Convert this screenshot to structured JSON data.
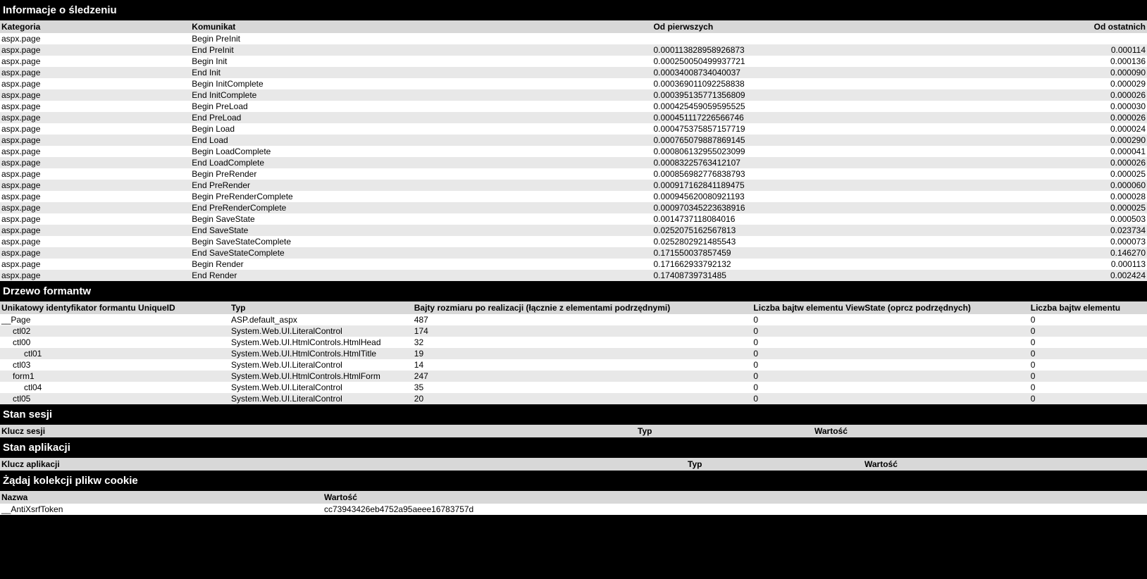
{
  "sections": {
    "trace_title": "Informacje o śledzeniu",
    "controltree_title": "Drzewo formantw",
    "session_title": "Stan sesji",
    "app_title": "Stan aplikacji",
    "cookies_title": "Żądaj kolekcji plikw cookie"
  },
  "trace": {
    "headers": {
      "category": "Kategoria",
      "message": "Komunikat",
      "from_first": "Od pierwszych",
      "from_last": "Od ostatnich"
    },
    "rows": [
      {
        "cat": "aspx.page",
        "msg": "Begin PreInit",
        "first": "",
        "last": ""
      },
      {
        "cat": "aspx.page",
        "msg": "End PreInit",
        "first": "0.000113828958926873",
        "last": "0.000114"
      },
      {
        "cat": "aspx.page",
        "msg": "Begin Init",
        "first": "0.000250050499937721",
        "last": "0.000136"
      },
      {
        "cat": "aspx.page",
        "msg": "End Init",
        "first": "0.00034008734040037",
        "last": "0.000090"
      },
      {
        "cat": "aspx.page",
        "msg": "Begin InitComplete",
        "first": "0.000369011092258838",
        "last": "0.000029"
      },
      {
        "cat": "aspx.page",
        "msg": "End InitComplete",
        "first": "0.000395135771356809",
        "last": "0.000026"
      },
      {
        "cat": "aspx.page",
        "msg": "Begin PreLoad",
        "first": "0.000425459059595525",
        "last": "0.000030"
      },
      {
        "cat": "aspx.page",
        "msg": "End PreLoad",
        "first": "0.000451117226566746",
        "last": "0.000026"
      },
      {
        "cat": "aspx.page",
        "msg": "Begin Load",
        "first": "0.000475375857157719",
        "last": "0.000024"
      },
      {
        "cat": "aspx.page",
        "msg": "End Load",
        "first": "0.000765079887869145",
        "last": "0.000290"
      },
      {
        "cat": "aspx.page",
        "msg": "Begin LoadComplete",
        "first": "0.000806132955023099",
        "last": "0.000041"
      },
      {
        "cat": "aspx.page",
        "msg": "End LoadComplete",
        "first": "0.00083225763412107",
        "last": "0.000026"
      },
      {
        "cat": "aspx.page",
        "msg": "Begin PreRender",
        "first": "0.000856982776838793",
        "last": "0.000025"
      },
      {
        "cat": "aspx.page",
        "msg": "End PreRender",
        "first": "0.000917162841189475",
        "last": "0.000060"
      },
      {
        "cat": "aspx.page",
        "msg": "Begin PreRenderComplete",
        "first": "0.000945620080921193",
        "last": "0.000028"
      },
      {
        "cat": "aspx.page",
        "msg": "End PreRenderComplete",
        "first": "0.000970345223638916",
        "last": "0.000025"
      },
      {
        "cat": "aspx.page",
        "msg": "Begin SaveState",
        "first": "0.0014737118084016",
        "last": "0.000503"
      },
      {
        "cat": "aspx.page",
        "msg": "End SaveState",
        "first": "0.0252075162567813",
        "last": "0.023734"
      },
      {
        "cat": "aspx.page",
        "msg": "Begin SaveStateComplete",
        "first": "0.0252802921485543",
        "last": "0.000073"
      },
      {
        "cat": "aspx.page",
        "msg": "End SaveStateComplete",
        "first": "0.171550037857459",
        "last": "0.146270"
      },
      {
        "cat": "aspx.page",
        "msg": "Begin Render",
        "first": "0.171662933792132",
        "last": "0.000113"
      },
      {
        "cat": "aspx.page",
        "msg": "End Render",
        "first": "0.17408739731485",
        "last": "0.002424"
      }
    ]
  },
  "controltree": {
    "headers": {
      "uid": "Unikatowy identyfikator formantu UniqueID",
      "type": "Typ",
      "render": "Bajty rozmiaru po realizacji (łącznie z elementami podrzędnymi)",
      "viewstate": "Liczba bajtw elementu ViewState (oprcz podrzędnych)",
      "controlstate": "Liczba bajtw elementu"
    },
    "rows": [
      {
        "indent": 0,
        "uid": "__Page",
        "type": "ASP.default_aspx",
        "render": "487",
        "vs": "0",
        "cs": "0"
      },
      {
        "indent": 1,
        "uid": "ctl02",
        "type": "System.Web.UI.LiteralControl",
        "render": "174",
        "vs": "0",
        "cs": "0"
      },
      {
        "indent": 1,
        "uid": "ctl00",
        "type": "System.Web.UI.HtmlControls.HtmlHead",
        "render": "32",
        "vs": "0",
        "cs": "0"
      },
      {
        "indent": 2,
        "uid": "ctl01",
        "type": "System.Web.UI.HtmlControls.HtmlTitle",
        "render": "19",
        "vs": "0",
        "cs": "0"
      },
      {
        "indent": 1,
        "uid": "ctl03",
        "type": "System.Web.UI.LiteralControl",
        "render": "14",
        "vs": "0",
        "cs": "0"
      },
      {
        "indent": 1,
        "uid": "form1",
        "type": "System.Web.UI.HtmlControls.HtmlForm",
        "render": "247",
        "vs": "0",
        "cs": "0"
      },
      {
        "indent": 2,
        "uid": "ctl04",
        "type": "System.Web.UI.LiteralControl",
        "render": "35",
        "vs": "0",
        "cs": "0"
      },
      {
        "indent": 1,
        "uid": "ctl05",
        "type": "System.Web.UI.LiteralControl",
        "render": "20",
        "vs": "0",
        "cs": "0"
      }
    ]
  },
  "session": {
    "headers": {
      "key": "Klucz sesji",
      "type": "Typ",
      "value": "Wartość"
    }
  },
  "app": {
    "headers": {
      "key": "Klucz aplikacji",
      "type": "Typ",
      "value": "Wartość"
    }
  },
  "cookies": {
    "headers": {
      "name": "Nazwa",
      "value": "Wartość"
    },
    "rows": [
      {
        "name": "__AntiXsrfToken",
        "value": "cc73943426eb4752a95aeee16783757d"
      }
    ]
  }
}
